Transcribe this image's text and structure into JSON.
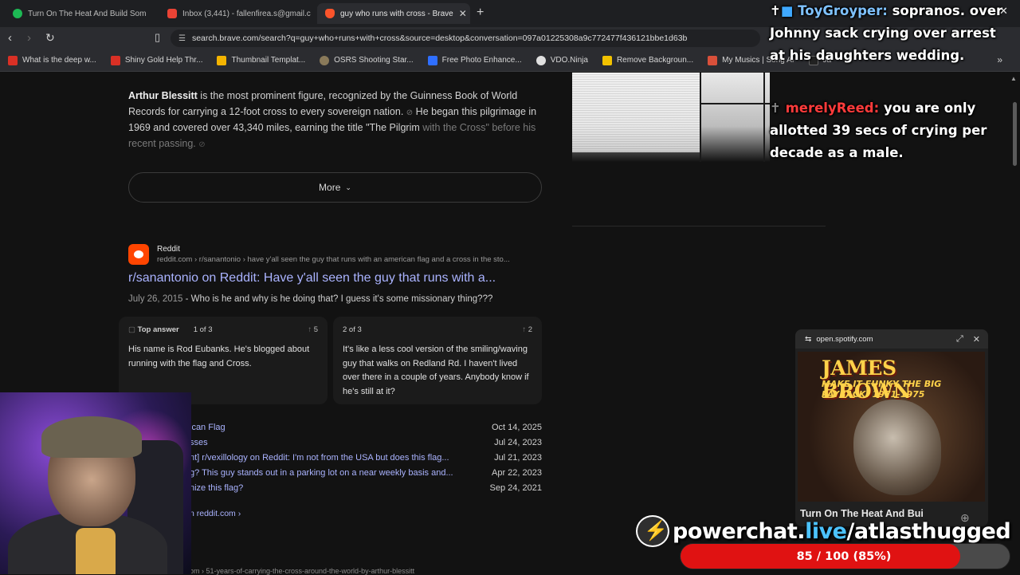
{
  "browser": {
    "tabs": [
      {
        "label": "Turn On The Heat And Build Som",
        "active": false,
        "favicon_color": "#1db954"
      },
      {
        "label": "Inbox (3,441) - fallenfirea.s@gmail.co",
        "active": false,
        "favicon_color": "#ea4335"
      },
      {
        "label": "guy who runs with cross - Brave",
        "active": true,
        "favicon_color": "#fb542b"
      }
    ],
    "url": "search.brave.com/search?q=guy+who+runs+with+cross&source=desktop&conversation=097a01225308a9c772477f436121bbe1d63b",
    "bookmarks": [
      {
        "label": "What is the deep w...",
        "favicon_color": "#d93025"
      },
      {
        "label": "Shiny Gold Help Thr...",
        "favicon_color": "#d93025"
      },
      {
        "label": "Thumbnail Templat...",
        "favicon_color": "#f4b400"
      },
      {
        "label": "OSRS Shooting Star...",
        "favicon_color": "#8a7a5a"
      },
      {
        "label": "Free Photo Enhance...",
        "favicon_color": "#2f6fff"
      },
      {
        "label": "VDO.Ninja",
        "favicon_color": "#e0e0e0"
      },
      {
        "label": "Remove Backgroun...",
        "favicon_color": "#f2c200"
      },
      {
        "label": "My Musics | Song AI",
        "favicon_color": "#d9503a"
      },
      {
        "label": "Ja",
        "favicon_color": "#222222"
      }
    ]
  },
  "answer": {
    "name": "Arthur Blessitt",
    "text1": " is the most prominent figure, recognized by the Guinness Book of World Records for carrying a 12-foot cross to every sovereign nation.",
    "text2": " He began this pilgrimage in 1969 and covered over 43,340 miles, earning the title \"The Pilgrim",
    "text_fade": "with the Cross\" before his recent passing.",
    "more_label": "More"
  },
  "result": {
    "site": "Reddit",
    "url": "reddit.com › r/sanantonio › have y'all seen the guy that runs with an american flag and a cross in the sto...",
    "title": "r/sanantonio on Reddit: Have y'all seen the guy that runs with a...",
    "date": "July 26, 2015",
    "snippet": "Who is he and why is he doing that? I guess it's some missionary thing???",
    "cards": [
      {
        "tag": "Top answer",
        "index": "1 of 3",
        "votes": "5",
        "body": "His name is Rod Eubanks. He's blogged about running with the flag and Cross."
      },
      {
        "tag": "",
        "index": "2 of 3",
        "votes": "2",
        "body": "It's like a less cool version of the smiling/waving guy that walks on Redland Rd. I haven't lived over there in a couple of years. Anybody know if he's still at it?"
      }
    ],
    "links": [
      {
        "text": "ican Flag",
        "date": "Oct 14, 2025"
      },
      {
        "text": "sses",
        "date": "Jul 24, 2023"
      },
      {
        "text": "nt] r/vexillology on Reddit: I'm not from the USA but does this flag...",
        "date": "Jul 21, 2023"
      },
      {
        "text": "g? This guy stands out in a parking lot on a near weekly basis and...",
        "date": "Apr 22, 2023"
      },
      {
        "text": "nize this flag?",
        "date": "Sep 24, 2021"
      }
    ],
    "more_from": "n reddit.com",
    "bottom_cut": "om › 51-years-of-carrying-the-cross-around-the-world-by-arthur-blessitt"
  },
  "chat": [
    {
      "user": "ToyGroyper:",
      "message": "sopranos. over Johnny sack crying over arrest at his daughters wedding."
    },
    {
      "user": "merelyReed:",
      "message": "you are only allotted 39 secs of crying per decade as a male."
    }
  ],
  "spotify": {
    "domain": "open.spotify.com",
    "album_artist": "JAMES BROWN",
    "album_title": "MAKE IT FUNKY  THE BIG PAYBACK: 1971-1975",
    "song": "Turn On The Heat And Bui"
  },
  "powerchat": {
    "domain_a": "powerchat.",
    "domain_b": "live",
    "domain_c": "/atlasthugged",
    "goal_text": "85 / 100 (85%)",
    "goal_fraction": 0.85
  }
}
